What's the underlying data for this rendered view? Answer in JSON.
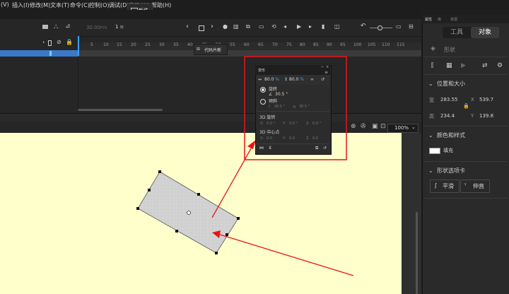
{
  "menu": {
    "items": [
      "(V)",
      "插入(I)",
      "修改(M)",
      "文本(T)",
      "命令(C)",
      "控制(O)",
      "调试(D)",
      "窗口(W)",
      "帮助(H)"
    ]
  },
  "workspace_tab": {
    "label": "新件"
  },
  "timeline": {
    "fps": "30.00",
    "fps_unit": "FPS",
    "frame": "1",
    "frame_unit": "帧",
    "ruler_ticks": [
      "5",
      "10",
      "15",
      "20",
      "25",
      "30",
      "35",
      "40",
      "45",
      "50",
      "55",
      "60",
      "65",
      "70",
      "75",
      "80",
      "85",
      "90",
      "95",
      "100",
      "105",
      "110",
      "115"
    ],
    "tooltip": "代码片断"
  },
  "stage": {
    "zoom": "100%"
  },
  "transform_panel": {
    "title": "变形",
    "width_pct": "80.0",
    "height_pct": "80.0",
    "pct_unit": "%",
    "rotate_label": "旋转",
    "rotate_value": "30.5",
    "skew_label": "倾斜",
    "skew_h": "30.5",
    "skew_v": "30.5",
    "deg": "°",
    "rot3d_label": "3D 旋转",
    "x_label": "X:",
    "y_label": "Y:",
    "z_label": "Z:",
    "rot3d_x": "0.0",
    "rot3d_y": "0.0",
    "rot3d_z": "0.0",
    "center3d_label": "3D 中心点",
    "c3d_x": "0.0",
    "c3d_y": "0.0",
    "c3d_z": "0.0"
  },
  "right_panel": {
    "tabs": [
      "属性",
      "库",
      "资源"
    ],
    "seg_tool": "工具",
    "seg_object": "对象",
    "shape_label": "形状",
    "pos_size_title": "位置和大小",
    "w_label": "宽",
    "w_value": "283.55",
    "h_label": "高",
    "h_value": "234.4",
    "x_label": "X",
    "x_value": "539.7",
    "y_label": "Y",
    "y_value": "139.8",
    "color_style_title": "颜色和样式",
    "fill_label": "填充",
    "shape_options_title": "形状选项卡",
    "smooth_label": "平滑",
    "straighten_label": "伸直"
  },
  "colors": {
    "annotation": "#e8141c",
    "stage_bg": "#ffffcc",
    "accent": "#3aa0ff"
  }
}
